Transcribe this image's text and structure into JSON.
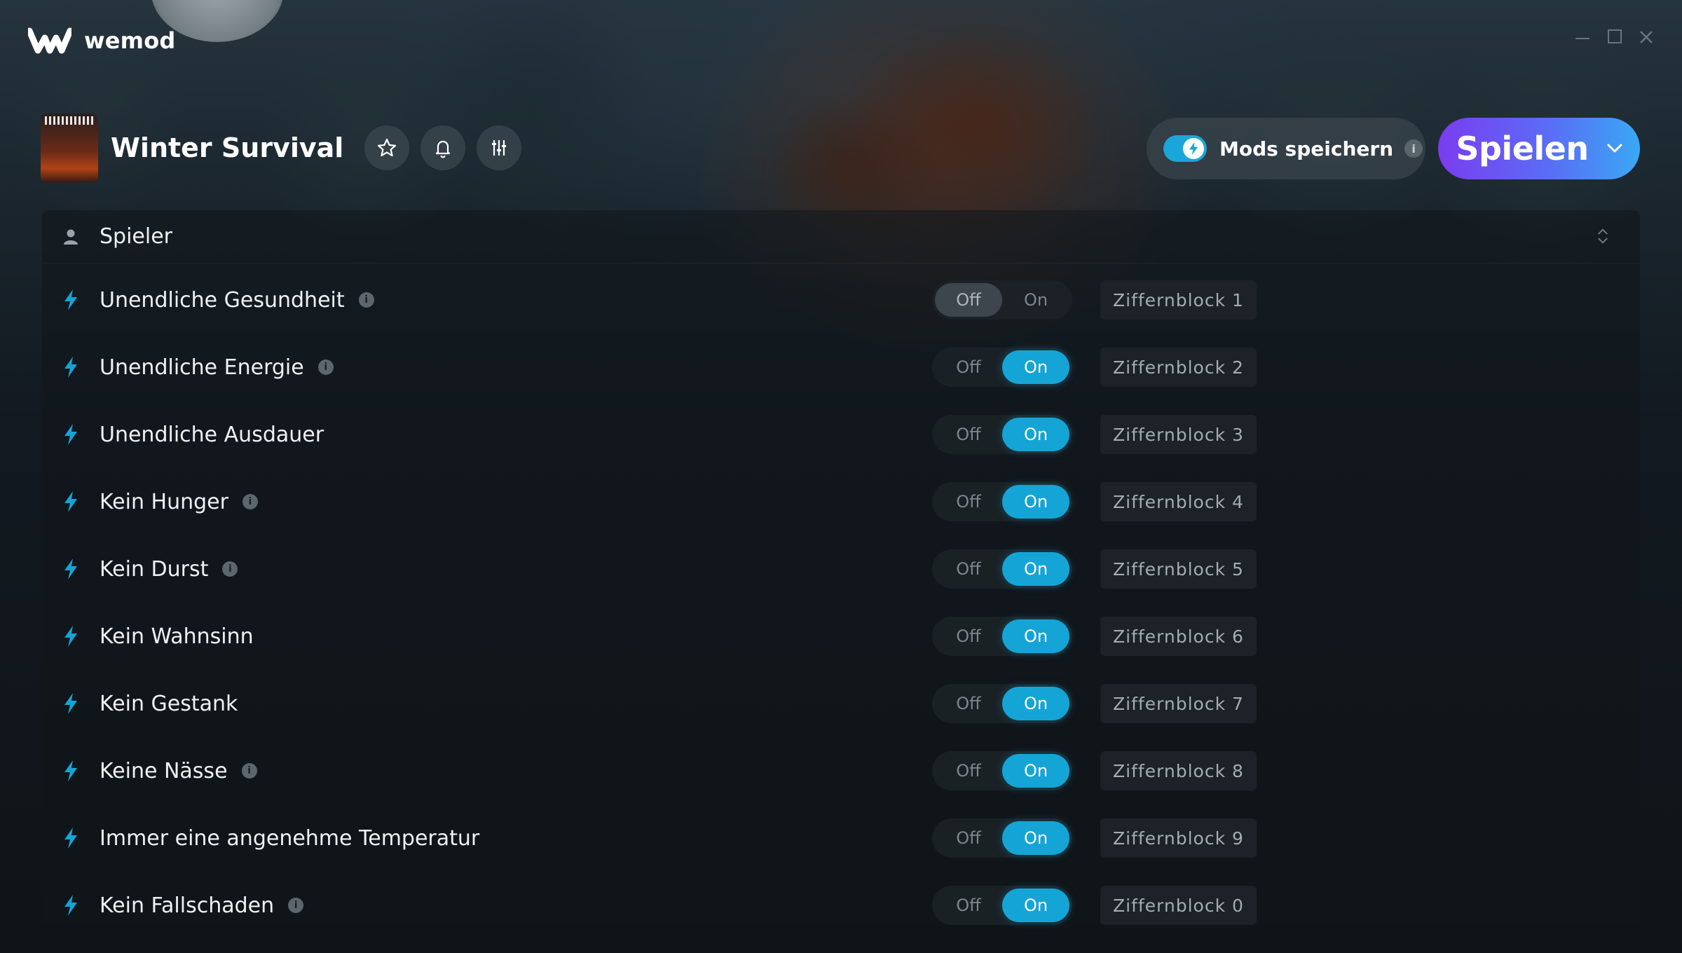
{
  "app": {
    "name": "wemod"
  },
  "header": {
    "game_title": "Winter Survival",
    "mods_save_label": "Mods speichern",
    "mods_save_info": "i",
    "mods_save_enabled": true,
    "play_label": "Spielen"
  },
  "section": {
    "title": "Spieler"
  },
  "toggle_labels": {
    "off": "Off",
    "on": "On"
  },
  "mods": [
    {
      "label": "Unendliche Gesundheit",
      "info": true,
      "state": "off",
      "hotkey": "Ziffernblock 1"
    },
    {
      "label": "Unendliche Energie",
      "info": true,
      "state": "on",
      "hotkey": "Ziffernblock 2"
    },
    {
      "label": "Unendliche Ausdauer",
      "info": false,
      "state": "on",
      "hotkey": "Ziffernblock 3"
    },
    {
      "label": "Kein Hunger",
      "info": true,
      "state": "on",
      "hotkey": "Ziffernblock 4"
    },
    {
      "label": "Kein Durst",
      "info": true,
      "state": "on",
      "hotkey": "Ziffernblock 5"
    },
    {
      "label": "Kein Wahnsinn",
      "info": false,
      "state": "on",
      "hotkey": "Ziffernblock 6"
    },
    {
      "label": "Kein Gestank",
      "info": false,
      "state": "on",
      "hotkey": "Ziffernblock 7"
    },
    {
      "label": "Keine Nässe",
      "info": true,
      "state": "on",
      "hotkey": "Ziffernblock 8"
    },
    {
      "label": "Immer eine angenehme Temperatur",
      "info": false,
      "state": "on",
      "hotkey": "Ziffernblock 9"
    },
    {
      "label": "Kein Fallschaden",
      "info": true,
      "state": "on",
      "hotkey": "Ziffernblock 0"
    }
  ],
  "colors": {
    "accent": "#14a5d6",
    "play_start": "#7b3cf0",
    "play_end": "#3aa8f5"
  }
}
